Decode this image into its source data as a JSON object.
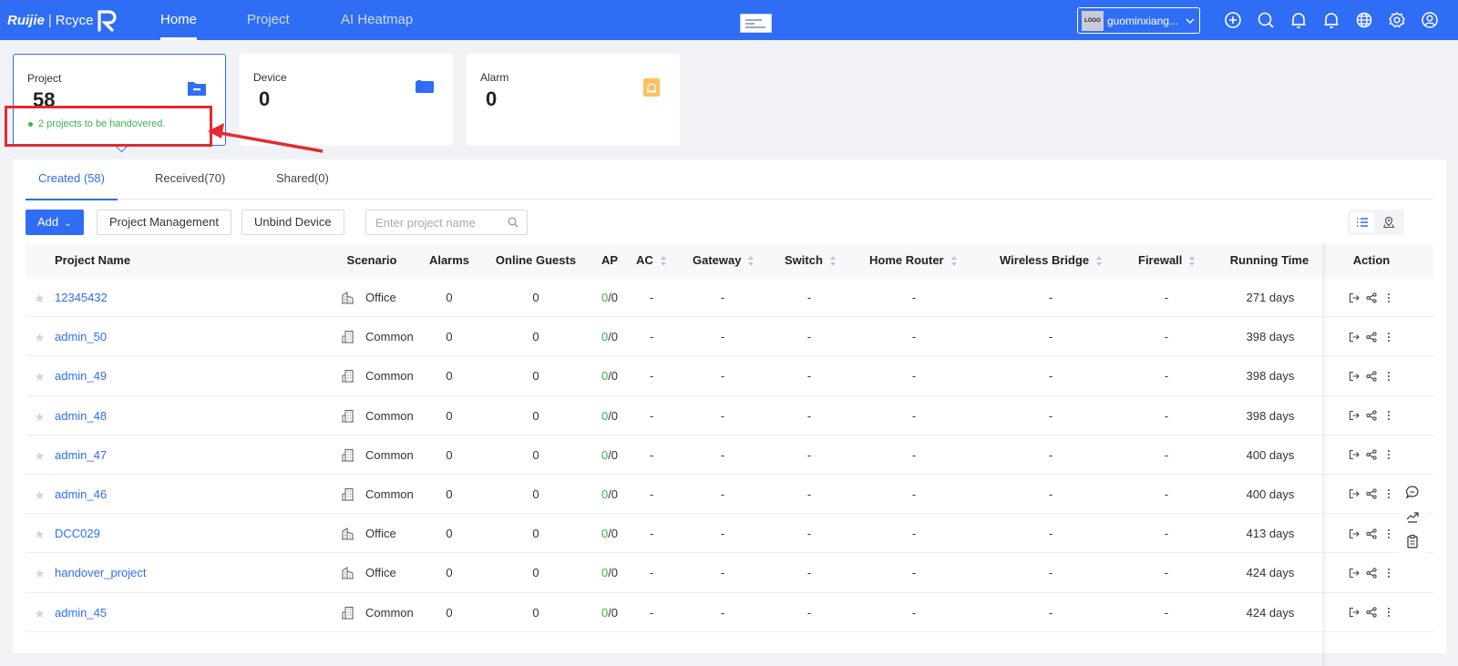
{
  "topbar": {
    "brand": "Ruijie",
    "brand_sub": "Rcyce",
    "nav": [
      "Home",
      "Project",
      "AI Heatmap"
    ],
    "tenant": {
      "logo_text": "LOGO",
      "name": "guominxiang..."
    },
    "icons": [
      "add-circle-icon",
      "search-icon",
      "bell-icon",
      "bell-alert-icon",
      "globe-icon",
      "gear-icon",
      "user-icon"
    ]
  },
  "cards": [
    {
      "title": "Project",
      "value": "58",
      "icon": "folder-icon",
      "note": "2 projects to be handovered."
    },
    {
      "title": "Device",
      "value": "0",
      "icon": "device-icon"
    },
    {
      "title": "Alarm",
      "value": "0",
      "icon": "alarm-light-icon"
    }
  ],
  "tabs": [
    "Created (58)",
    "Received(70)",
    "Shared(0)"
  ],
  "toolbar": {
    "add_label": "Add",
    "project_mgmt_label": "Project Management",
    "unbind_label": "Unbind Device",
    "search_placeholder": "Enter project name"
  },
  "table": {
    "headers": {
      "name": "Project Name",
      "scenario": "Scenario",
      "alarms": "Alarms",
      "guests": "Online Guests",
      "ap": "AP",
      "ac": "AC",
      "gateway": "Gateway",
      "switch": "Switch",
      "home_router": "Home Router",
      "wireless_bridge": "Wireless Bridge",
      "firewall": "Firewall",
      "running_time": "Running Time",
      "action": "Action"
    },
    "rows": [
      {
        "name": "12345432",
        "scenario": "Office",
        "alarms": "0",
        "guests": "0",
        "ap_online": "0",
        "ap_total": "/0",
        "ac": "-",
        "gateway": "-",
        "switch": "-",
        "home_router": "-",
        "wireless_bridge": "-",
        "firewall": "-",
        "running_time": "271 days"
      },
      {
        "name": "admin_50",
        "scenario": "Common",
        "alarms": "0",
        "guests": "0",
        "ap_online": "0",
        "ap_total": "/0",
        "ac": "-",
        "gateway": "-",
        "switch": "-",
        "home_router": "-",
        "wireless_bridge": "-",
        "firewall": "-",
        "running_time": "398 days"
      },
      {
        "name": "admin_49",
        "scenario": "Common",
        "alarms": "0",
        "guests": "0",
        "ap_online": "0",
        "ap_total": "/0",
        "ac": "-",
        "gateway": "-",
        "switch": "-",
        "home_router": "-",
        "wireless_bridge": "-",
        "firewall": "-",
        "running_time": "398 days"
      },
      {
        "name": "admin_48",
        "scenario": "Common",
        "alarms": "0",
        "guests": "0",
        "ap_online": "0",
        "ap_total": "/0",
        "ac": "-",
        "gateway": "-",
        "switch": "-",
        "home_router": "-",
        "wireless_bridge": "-",
        "firewall": "-",
        "running_time": "398 days"
      },
      {
        "name": "admin_47",
        "scenario": "Common",
        "alarms": "0",
        "guests": "0",
        "ap_online": "0",
        "ap_total": "/0",
        "ac": "-",
        "gateway": "-",
        "switch": "-",
        "home_router": "-",
        "wireless_bridge": "-",
        "firewall": "-",
        "running_time": "400 days"
      },
      {
        "name": "admin_46",
        "scenario": "Common",
        "alarms": "0",
        "guests": "0",
        "ap_online": "0",
        "ap_total": "/0",
        "ac": "-",
        "gateway": "-",
        "switch": "-",
        "home_router": "-",
        "wireless_bridge": "-",
        "firewall": "-",
        "running_time": "400 days"
      },
      {
        "name": "DCC029",
        "scenario": "Office",
        "alarms": "0",
        "guests": "0",
        "ap_online": "0",
        "ap_total": "/0",
        "ac": "-",
        "gateway": "-",
        "switch": "-",
        "home_router": "-",
        "wireless_bridge": "-",
        "firewall": "-",
        "running_time": "413 days"
      },
      {
        "name": "handover_project",
        "scenario": "Office",
        "alarms": "0",
        "guests": "0",
        "ap_online": "0",
        "ap_total": "/0",
        "ac": "-",
        "gateway": "-",
        "switch": "-",
        "home_router": "-",
        "wireless_bridge": "-",
        "firewall": "-",
        "running_time": "424 days"
      },
      {
        "name": "admin_45",
        "scenario": "Common",
        "alarms": "0",
        "guests": "0",
        "ap_online": "0",
        "ap_total": "/0",
        "ac": "-",
        "gateway": "-",
        "switch": "-",
        "home_router": "-",
        "wireless_bridge": "-",
        "firewall": "-",
        "running_time": "424 days"
      }
    ]
  },
  "side_tools": [
    "chat-icon",
    "handshake-icon",
    "clipboard-icon"
  ],
  "colors": {
    "primary": "#2f6df4",
    "success": "#3bb34a",
    "annotation": "#e32a2f"
  }
}
